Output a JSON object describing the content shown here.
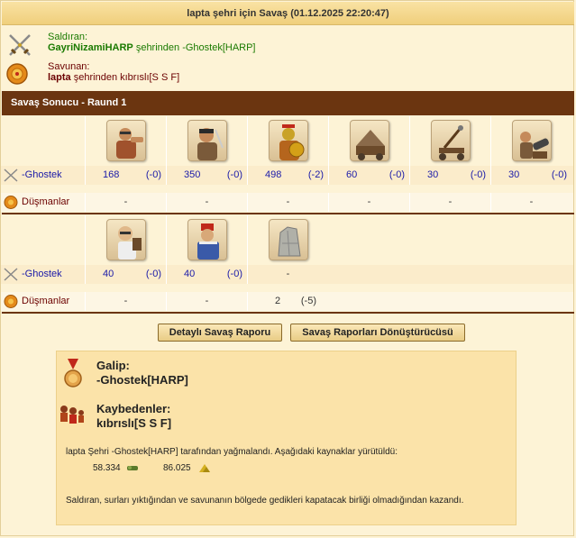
{
  "title": "lapta şehri için Savaş (01.12.2025 22:20:47)",
  "attacker": {
    "label": "Saldıran:",
    "name": "GayriNizamiHARP",
    "rest": " şehrinden -Ghostek[HARP]"
  },
  "defender": {
    "label": "Savunan:",
    "name": "lapta",
    "rest": " şehrinden kıbrıslı[S S F]"
  },
  "section_title": "Savaş Sonucu - Raund 1",
  "round1": {
    "units": [
      "slinger-unit",
      "swordsman-unit",
      "hoplite-unit",
      "ram-unit",
      "catapult-unit",
      "mortar-unit"
    ],
    "own_label": "-Ghostek",
    "own": [
      {
        "count": "168",
        "loss": "(-0)"
      },
      {
        "count": "350",
        "loss": "(-0)"
      },
      {
        "count": "498",
        "loss": "(-2)"
      },
      {
        "count": "60",
        "loss": "(-0)"
      },
      {
        "count": "30",
        "loss": "(-0)"
      },
      {
        "count": "30",
        "loss": "(-0)"
      }
    ],
    "enemy_label": "Düşmanlar",
    "enemy": [
      "-",
      "-",
      "-",
      "-",
      "-",
      "-"
    ]
  },
  "round2": {
    "units": [
      "doctor-unit",
      "cook-unit",
      "wall-unit"
    ],
    "own_label": "-Ghostek",
    "own": [
      {
        "count": "40",
        "loss": "(-0)"
      },
      {
        "count": "40",
        "loss": "(-0)"
      },
      {
        "count": "-",
        "loss": ""
      }
    ],
    "enemy_label": "Düşmanlar",
    "enemy": [
      {
        "count": "-",
        "loss": ""
      },
      {
        "count": "-",
        "loss": ""
      },
      {
        "count": "2",
        "loss": "(-5)"
      }
    ]
  },
  "buttons": {
    "detailed": "Detaylı Savaş Raporu",
    "converter": "Savaş Raporları Dönüştürücüsü"
  },
  "result": {
    "winner_label": "Galip:",
    "winner": "-Ghostek[HARP]",
    "losers_label": "Kaybedenler:",
    "losers": "kıbrıslı[S S F]",
    "plunder_text": "lapta Şehri -Ghostek[HARP] tarafından yağmalandı. Aşağıdaki kaynaklar yürütüldü:",
    "wood": "58.334",
    "sulfur": "86.025",
    "note": "Saldıran, surları yıktığından ve savunanın bölgede gedikleri kapatacak birliği olmadığından kazandı."
  },
  "colors": {
    "header_bar": "#6b3510",
    "link_green": "#1a7a00",
    "defender_maroon": "#6b0000",
    "count_blue": "#1a1aa8"
  }
}
